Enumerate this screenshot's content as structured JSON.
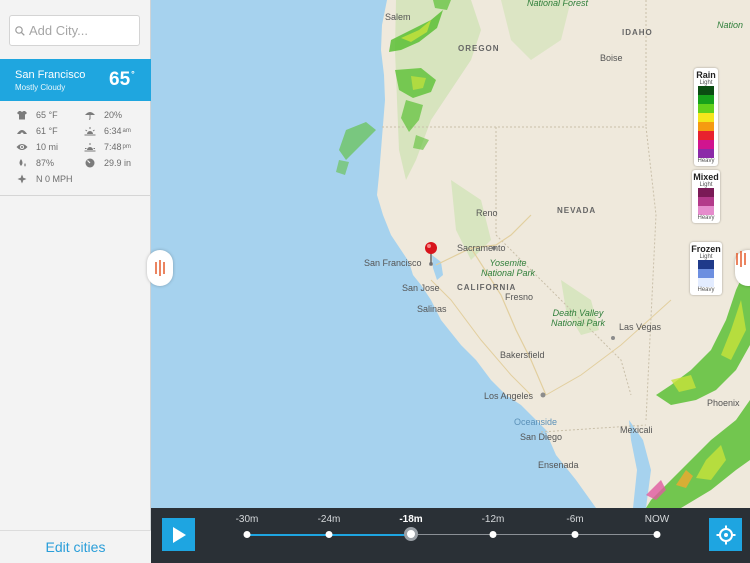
{
  "search": {
    "placeholder": "Add City..."
  },
  "city": {
    "name": "San Francisco",
    "condition": "Mostly Cloudy",
    "temp": "65",
    "deg": "°"
  },
  "stats": {
    "feels_like": "65 °F",
    "precip": "20%",
    "dew_point": "61 °F",
    "sunrise": "6:34",
    "sunrise_unit": "am",
    "visibility": "10 mi",
    "sunset": "7:48",
    "sunset_unit": "pm",
    "humidity": "87%",
    "pressure": "29.9 in",
    "wind": "N 0 MPH"
  },
  "edit_label": "Edit cities",
  "map": {
    "places": {
      "salem": "Salem",
      "national_forest": "National Forest",
      "oregon": "OREGON",
      "idaho": "IDAHO",
      "boise": "Boise",
      "nevada": "NEVADA",
      "reno": "Reno",
      "sacramento": "Sacramento",
      "san_francisco": "San Francisco",
      "san_jose": "San Jose",
      "california": "CALIFORNIA",
      "fresno": "Fresno",
      "salinas": "Salinas",
      "yosemite": "Yosemite National Park",
      "death_valley": "Death Valley National Park",
      "las_vegas": "Las Vegas",
      "bakersfield": "Bakersfield",
      "los_angeles": "Los Angeles",
      "oceanside": "Oceanside",
      "san_diego": "San Diego",
      "mexicali": "Mexicali",
      "ensenada": "Ensenada",
      "phoenix": "Phoenix",
      "national_partial": "Nation"
    }
  },
  "legend": {
    "rain": {
      "title": "Rain",
      "light": "Light",
      "heavy": "Heavy",
      "colors": [
        "#0b4d12",
        "#17a21b",
        "#63d11b",
        "#f4e61c",
        "#f59b11",
        "#e8222e",
        "#d1148f",
        "#8c2aa8"
      ]
    },
    "mixed": {
      "title": "Mixed",
      "light": "Light",
      "heavy": "Heavy",
      "colors": [
        "#7a1a56",
        "#b33a8a",
        "#e58ccc"
      ]
    },
    "frozen": {
      "title": "Frozen",
      "light": "Light",
      "heavy": "Heavy",
      "colors": [
        "#1f3a8a",
        "#6d8fe0",
        "#e3ecff"
      ]
    }
  },
  "timeline": {
    "labels": [
      "-30m",
      "-24m",
      "-18m",
      "-12m",
      "-6m",
      "NOW"
    ],
    "current": "-18m"
  },
  "colors": {
    "accent": "#1ea5e1",
    "timeline_bg": "#2a3036"
  }
}
